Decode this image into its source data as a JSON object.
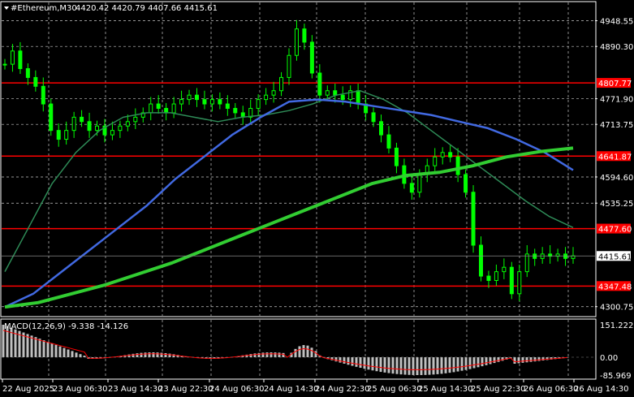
{
  "header": {
    "symbol_label": "#Ethereum,M30",
    "ohlc": "4420.42 4420.79 4407.66 4415.61"
  },
  "price_axis": {
    "ticks": [
      "4948.55",
      "4890.30",
      "4771.90",
      "4713.75",
      "4594.60",
      "4535.25",
      "4300.75"
    ]
  },
  "levels": [
    {
      "label": "4807.77",
      "value": 4807.77,
      "color": "#ff0000"
    },
    {
      "label": "4641.87",
      "value": 4641.87,
      "color": "#ff0000"
    },
    {
      "label": "4477.60",
      "value": 4477.6,
      "color": "#ff0000"
    },
    {
      "label": "4347.48",
      "value": 4347.48,
      "color": "#ff0000"
    }
  ],
  "current_price": {
    "label": "4415.61",
    "value": 4415.61
  },
  "macd": {
    "label": "MACD(12,26,9) -9.338 -14.126",
    "ticks": [
      "151.222",
      "0.00",
      "-85.969"
    ]
  },
  "time_axis": {
    "labels": [
      "22 Aug 2025",
      "23 Aug 06:30",
      "23 Aug 14:30",
      "23 Aug 22:30",
      "24 Aug 06:30",
      "24 Aug 14:30",
      "24 Aug 22:30",
      "25 Aug 06:30",
      "25 Aug 14:30",
      "25 Aug 22:30",
      "26 Aug 06:30",
      "26 Aug 14:30"
    ]
  },
  "colors": {
    "background": "#000000",
    "grid": "#c8c8c8",
    "candles": "#00ff00",
    "ma_fast": "#2e8b57",
    "ma_mid": "#4169e1",
    "ma_slow": "#32cd32",
    "macd_signal": "#ff0000",
    "macd_hist": "#c0c0c0"
  },
  "chart_data": {
    "type": "candlestick",
    "symbol": "#Ethereum",
    "timeframe": "M30",
    "ylim": [
      4280,
      4990
    ],
    "close": [
      4850,
      4880,
      4840,
      4820,
      4800,
      4760,
      4700,
      4680,
      4700,
      4730,
      4720,
      4700,
      4710,
      4690,
      4700,
      4710,
      4720,
      4730,
      4740,
      4760,
      4750,
      4740,
      4760,
      4770,
      4780,
      4770,
      4760,
      4770,
      4760,
      4750,
      4740,
      4730,
      4750,
      4770,
      4780,
      4790,
      4820,
      4870,
      4930,
      4900,
      4830,
      4780,
      4790,
      4780,
      4770,
      4790,
      4760,
      4740,
      4720,
      4690,
      4660,
      4620,
      4580,
      4560,
      4600,
      4620,
      4640,
      4650,
      4640,
      4600,
      4560,
      4440,
      4370,
      4360,
      4380,
      4390,
      4330,
      4380,
      4420,
      4410,
      4420,
      4415,
      4420,
      4410,
      4416
    ],
    "ma_fast": [
      4380,
      4480,
      4580,
      4650,
      4700,
      4730,
      4740,
      4740,
      4730,
      4720,
      4730,
      4735,
      4745,
      4760,
      4780,
      4790,
      4770,
      4740,
      4700,
      4660,
      4620,
      4580,
      4540,
      4505,
      4480
    ],
    "ma_mid": [
      4300,
      4330,
      4380,
      4430,
      4480,
      4530,
      4590,
      4640,
      4690,
      4730,
      4765,
      4770,
      4765,
      4755,
      4745,
      4735,
      4720,
      4705,
      4680,
      4650,
      4610
    ],
    "ma_slow": [
      4300,
      4310,
      4330,
      4350,
      4375,
      4400,
      4430,
      4460,
      4490,
      4520,
      4550,
      4580,
      4598,
      4605,
      4620,
      4640,
      4652,
      4660
    ]
  }
}
